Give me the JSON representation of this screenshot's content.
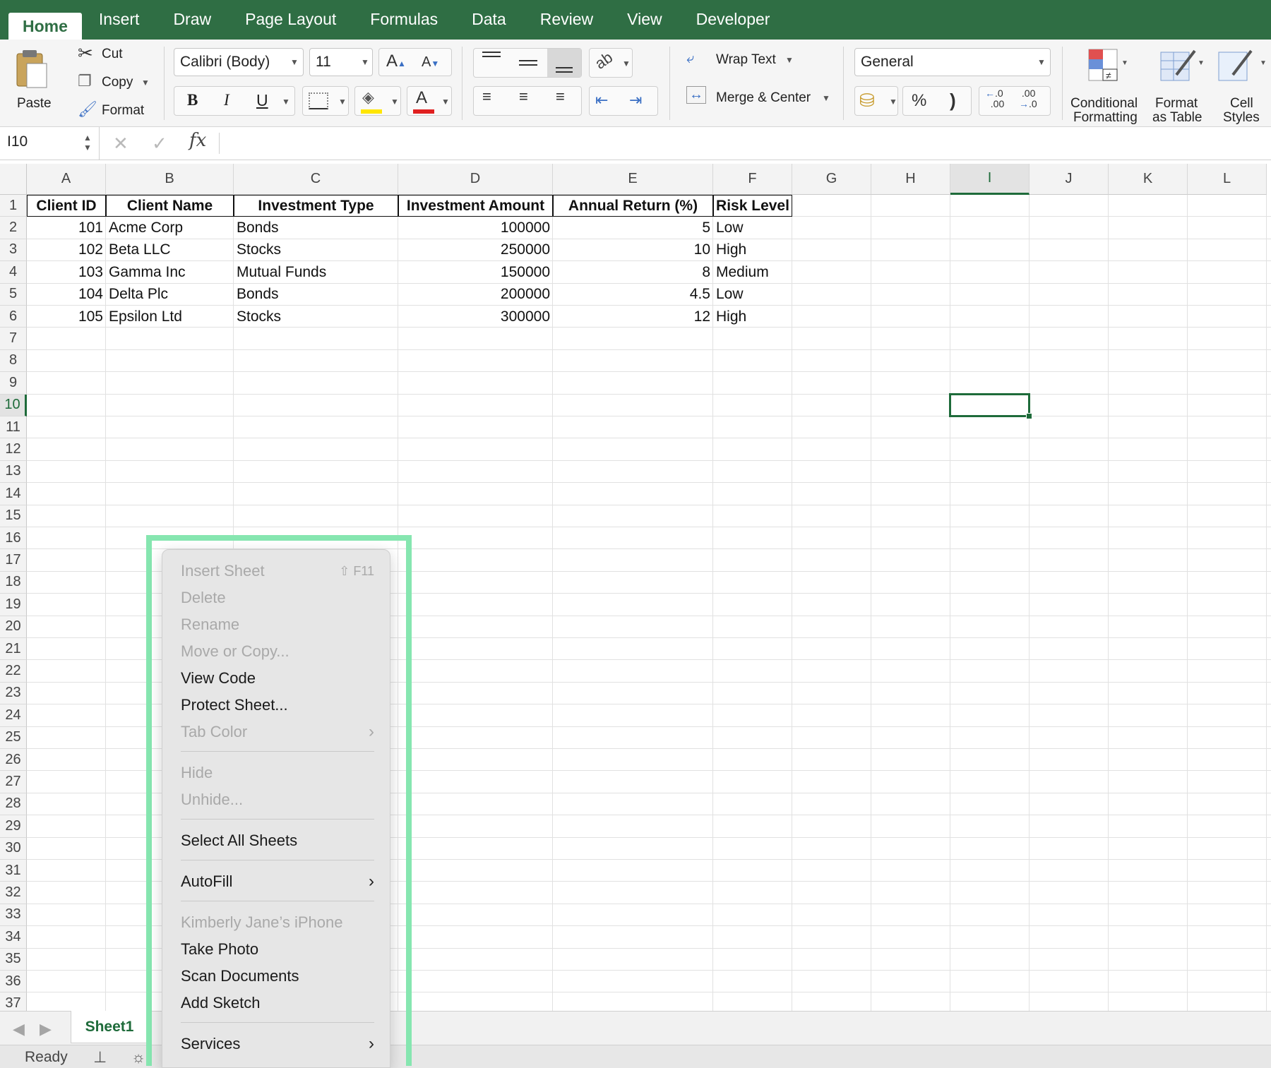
{
  "ribbon_tabs": [
    {
      "label": "Home",
      "active": true
    },
    {
      "label": "Insert"
    },
    {
      "label": "Draw"
    },
    {
      "label": "Page Layout"
    },
    {
      "label": "Formulas"
    },
    {
      "label": "Data"
    },
    {
      "label": "Review"
    },
    {
      "label": "View"
    },
    {
      "label": "Developer"
    }
  ],
  "clipboard": {
    "paste": "Paste",
    "cut": "Cut",
    "copy": "Copy",
    "format": "Format"
  },
  "font": {
    "name": "Calibri (Body)",
    "size": "11",
    "bold": "B",
    "italic": "I",
    "underline": "U"
  },
  "alignment": {
    "wrap_text": "Wrap Text",
    "merge_center": "Merge & Center"
  },
  "number": {
    "format": "General",
    "percent": "%",
    "comma": ")",
    "inc_decimal": ".0\n.00",
    "dec_decimal": ".00\n.0"
  },
  "styles": {
    "conditional_1": "Conditional",
    "conditional_2": "Formatting",
    "format_table_1": "Format",
    "format_table_2": "as Table",
    "cell_styles_1": "Cell",
    "cell_styles_2": "Styles"
  },
  "formula_bar": {
    "name_box": "I10",
    "fx": "fx",
    "cancel": "✕",
    "enter": "✓",
    "formula": ""
  },
  "columns": [
    "A",
    "B",
    "C",
    "D",
    "E",
    "F",
    "G",
    "H",
    "I",
    "J",
    "K",
    "L"
  ],
  "selected_column": "I",
  "selected_row": "10",
  "rows": [
    "1",
    "2",
    "3",
    "4",
    "5",
    "6",
    "7",
    "8",
    "9",
    "10",
    "11",
    "12",
    "13",
    "14",
    "15",
    "16",
    "17",
    "18",
    "19",
    "20",
    "21",
    "22",
    "23",
    "24",
    "25",
    "26",
    "27",
    "28",
    "29",
    "30",
    "31",
    "32",
    "33",
    "34",
    "35",
    "36",
    "37"
  ],
  "table": {
    "headers": [
      "Client ID",
      "Client Name",
      "Investment Type",
      "Investment Amount",
      "Annual Return (%)",
      "Risk Level"
    ],
    "rows": [
      [
        "101",
        "Acme Corp",
        "Bonds",
        "100000",
        "5",
        "Low"
      ],
      [
        "102",
        "Beta LLC",
        "Stocks",
        "250000",
        "10",
        "High"
      ],
      [
        "103",
        "Gamma Inc",
        "Mutual Funds",
        "150000",
        "8",
        "Medium"
      ],
      [
        "104",
        "Delta Plc",
        "Bonds",
        "200000",
        "4.5",
        "Low"
      ],
      [
        "105",
        "Epsilon Ltd",
        "Stocks",
        "300000",
        "12",
        "High"
      ]
    ]
  },
  "sheet_tabs": [
    {
      "label": "Sheet1",
      "active": true
    }
  ],
  "status": {
    "text": "Ready"
  },
  "context_menu": {
    "items": [
      {
        "label": "Insert Sheet",
        "shortcut": "⇧ F11",
        "disabled": true
      },
      {
        "label": "Delete",
        "disabled": true
      },
      {
        "label": "Rename",
        "disabled": true
      },
      {
        "label": "Move or Copy...",
        "disabled": true
      },
      {
        "label": "View Code",
        "disabled": false
      },
      {
        "label": "Protect Sheet...",
        "disabled": false
      },
      {
        "label": "Tab Color",
        "disabled": true,
        "submenu": true
      },
      {
        "label": "Hide",
        "disabled": true
      },
      {
        "label": "Unhide...",
        "disabled": true
      },
      {
        "label": "Select All Sheets",
        "disabled": false
      },
      {
        "label": "AutoFill",
        "disabled": false,
        "submenu": true
      },
      {
        "label": "Kimberly Jane’s iPhone",
        "disabled": true
      },
      {
        "label": "Take Photo",
        "disabled": false
      },
      {
        "label": "Scan Documents",
        "disabled": false
      },
      {
        "label": "Add Sketch",
        "disabled": false
      },
      {
        "label": "Services",
        "disabled": false,
        "submenu": true
      }
    ],
    "chevron": "›"
  },
  "colors": {
    "accent": "#2f6e44",
    "selection": "#1e6b3a",
    "highlight": "#86e6b0"
  }
}
